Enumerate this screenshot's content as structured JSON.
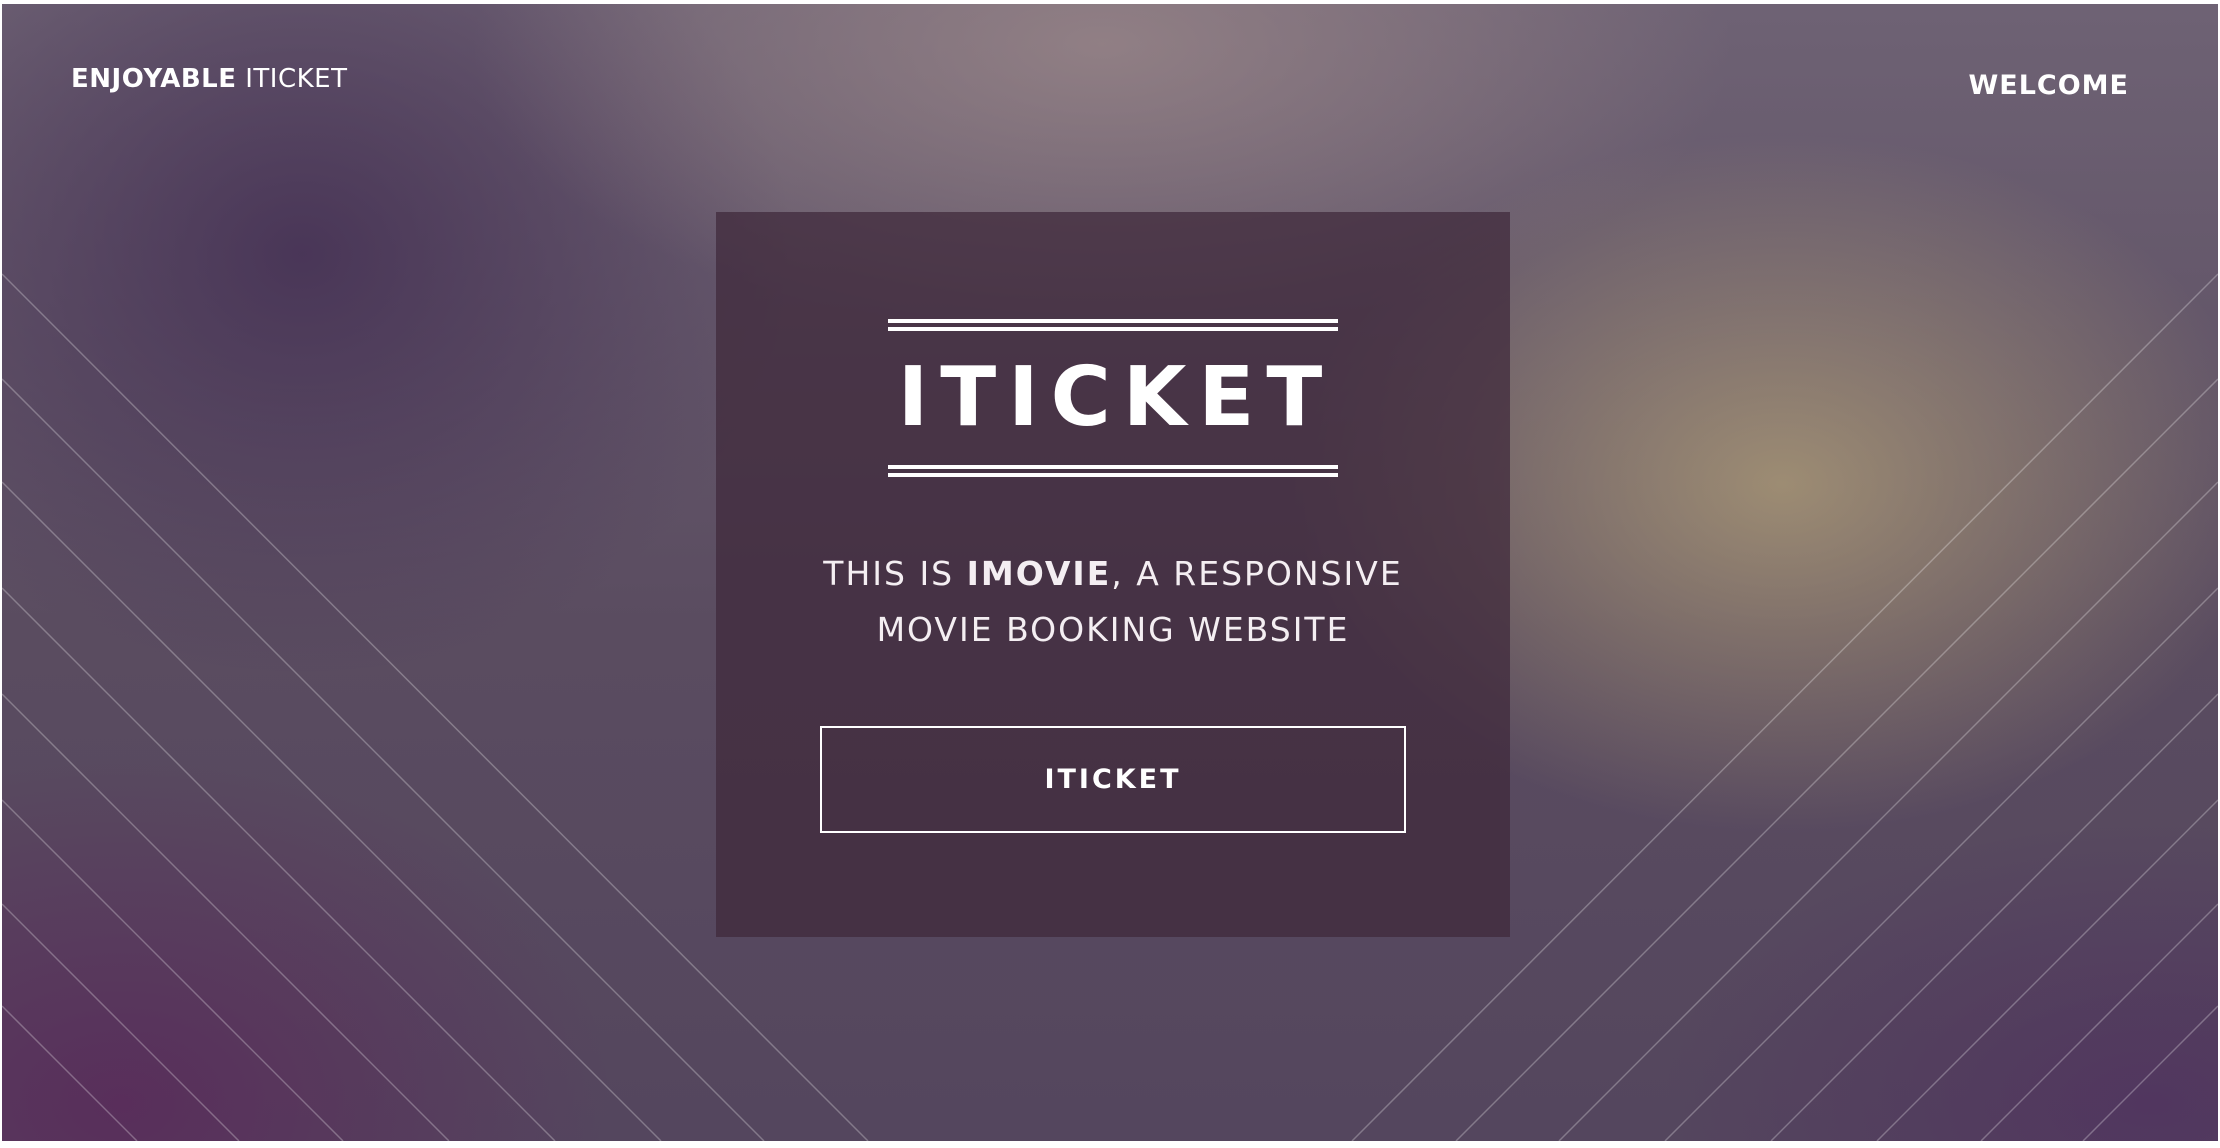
{
  "header": {
    "brand_strong": "ENJOYABLE",
    "brand_light": "ITICKET",
    "nav_welcome": "WELCOME"
  },
  "hero": {
    "logo_text": "ITICKET",
    "tagline_prefix": "THIS IS ",
    "tagline_highlight": "IMOVIE",
    "tagline_suffix": ", A RESPONSIVE",
    "tagline_line2": "MOVIE BOOKING WEBSITE",
    "button_label": "ITICKET"
  },
  "colors": {
    "text": "#ffffff",
    "card_background": "#3e283a",
    "background_purple": "#5a4c60",
    "background_gold": "#b2a078"
  }
}
